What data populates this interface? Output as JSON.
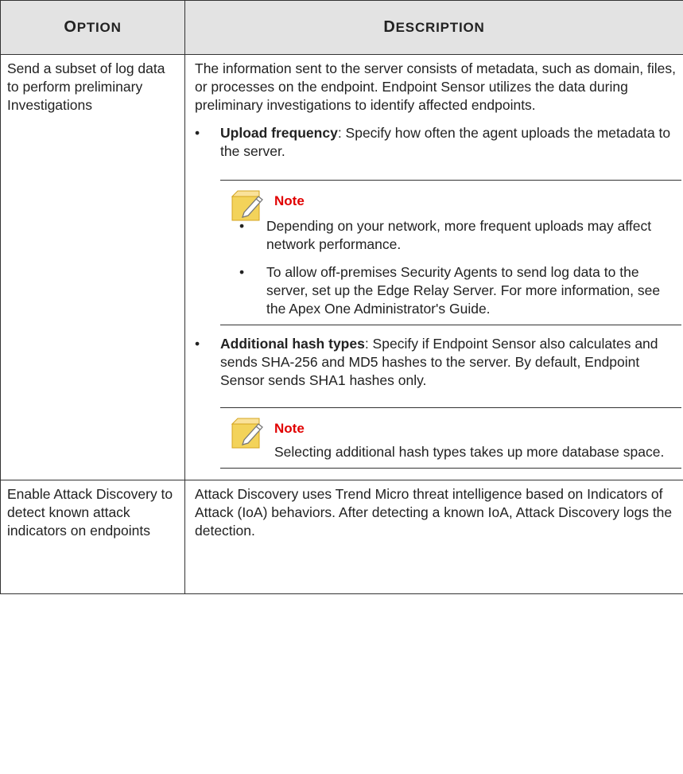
{
  "header": {
    "option": "Option",
    "description": "Description"
  },
  "rows": [
    {
      "option": "Send a subset of log data to perform preliminary Investigations",
      "intro": "The information sent to the server consists of metadata, such as domain, files, or processes on the endpoint. Endpoint Sensor utilizes the data during preliminary investigations to identify affected endpoints.",
      "bullets": [
        {
          "term": "Upload frequency",
          "text": ": Specify how often the agent uploads the metadata to the server.",
          "note": {
            "title": "Note",
            "items": [
              "Depending on your network, more frequent uploads may affect network performance.",
              "To allow off-premises Security Agents to send log data to the server, set up the Edge Relay Server. For more information, see the Apex One Administrator's Guide."
            ]
          }
        },
        {
          "term": "Additional hash types",
          "text": ": Specify if Endpoint Sensor also calculates and sends SHA-256 and MD5 hashes to the server. By default, Endpoint Sensor sends SHA1 hashes only.",
          "note": {
            "title": "Note",
            "text": "Selecting additional hash types takes up more database space."
          }
        }
      ]
    },
    {
      "option": "Enable Attack Discovery to detect known attack indicators on endpoints",
      "description": "Attack Discovery uses Trend Micro threat intelligence based on Indicators of Attack (IoA) behaviors. After detecting a known IoA, Attack Discovery logs the detection."
    }
  ],
  "bullet_glyph": "•",
  "icons": {
    "note": "note-pencil-icon"
  },
  "colors": {
    "note_title": "#e10000",
    "header_bg": "#e3e3e3",
    "note_icon": "#f3d35a"
  }
}
